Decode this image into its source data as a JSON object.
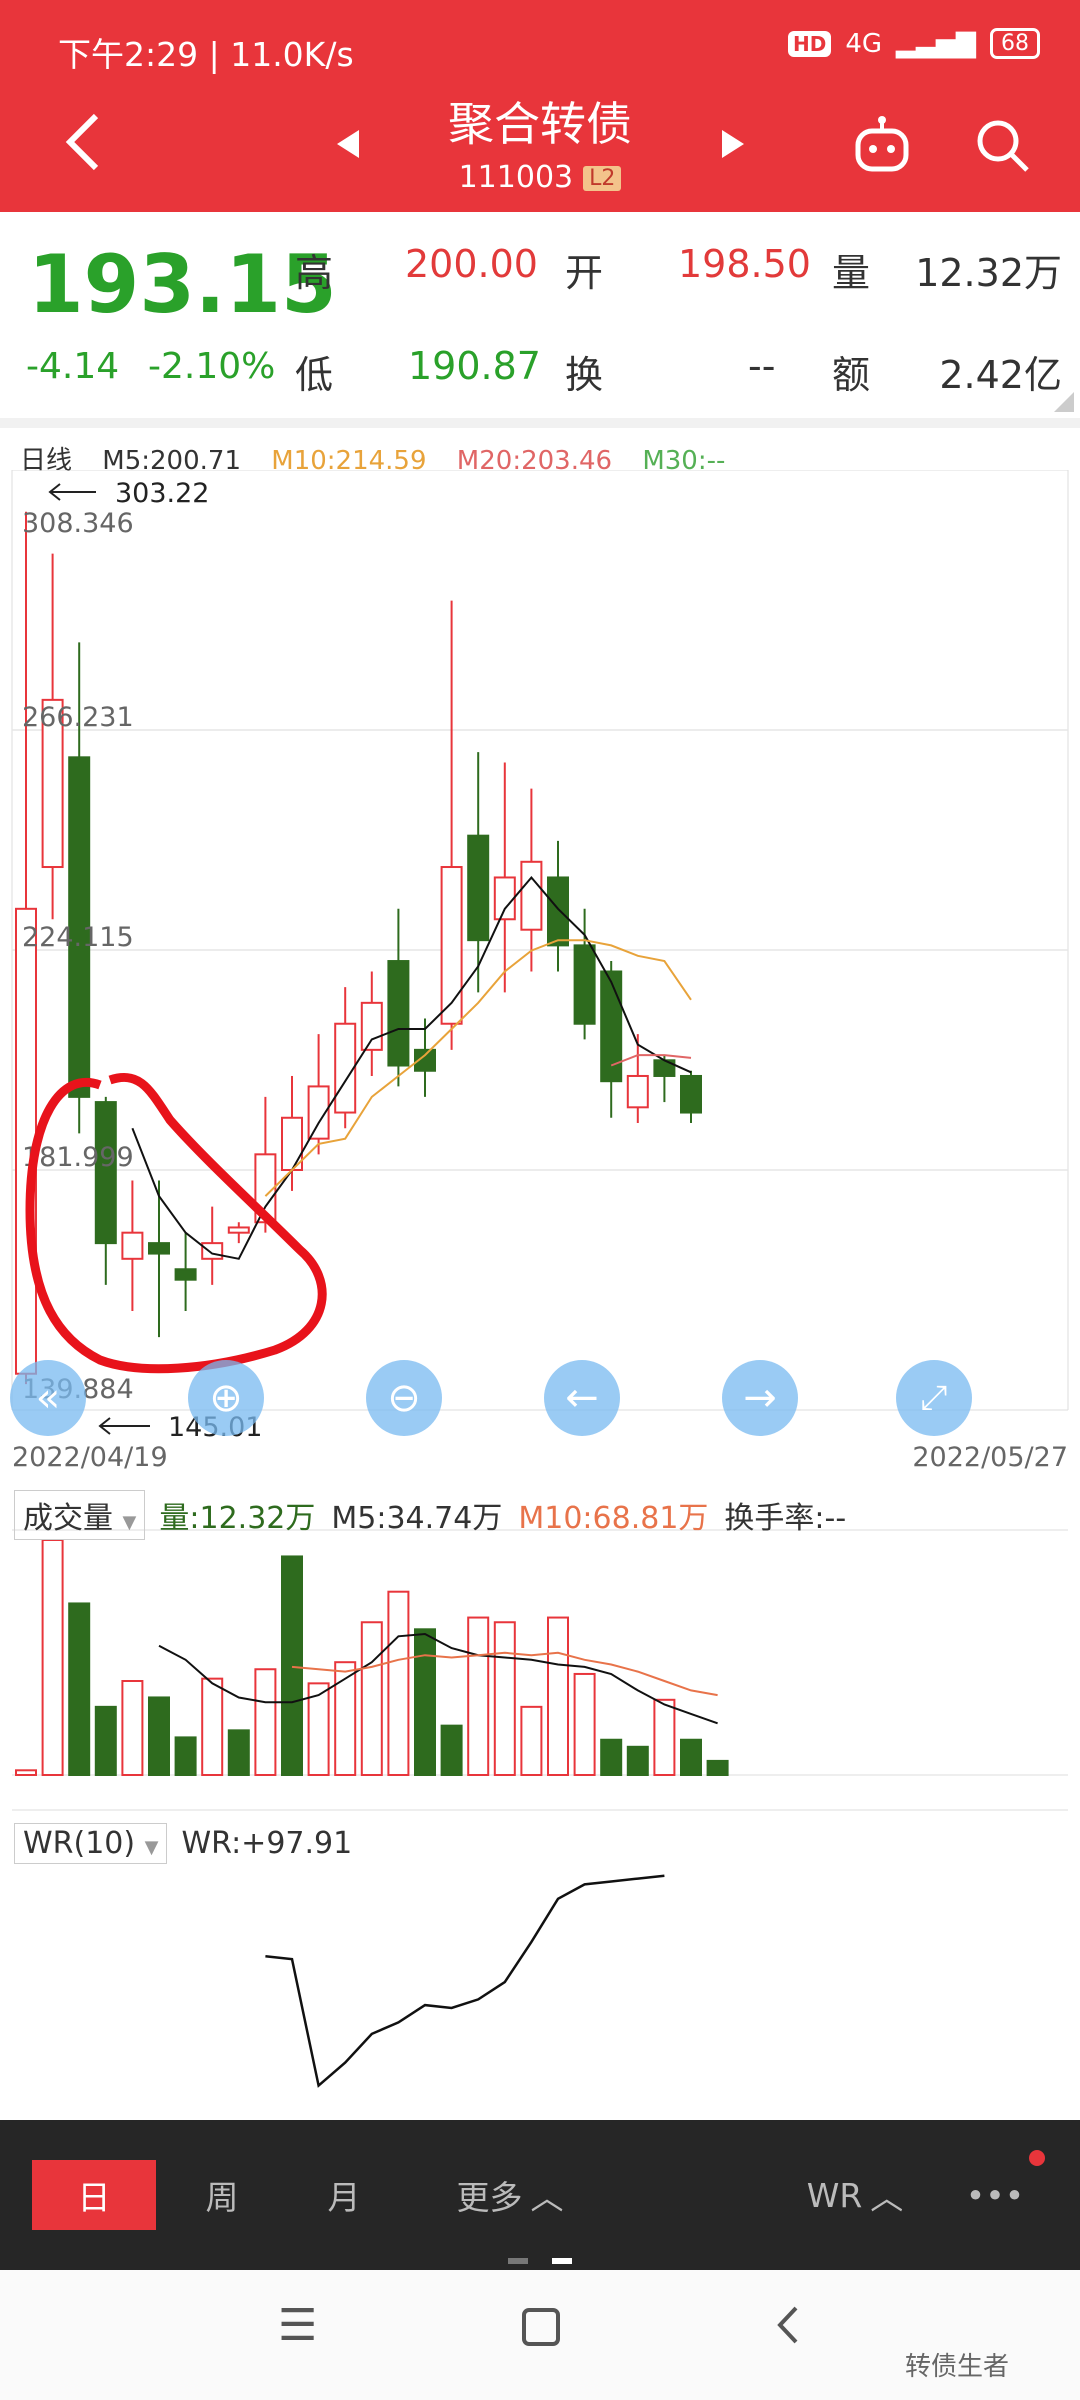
{
  "status": {
    "time": "下午2:29 | 11.0K/s",
    "hd": "HD",
    "net": "4G",
    "battery": "68"
  },
  "header": {
    "title": "聚合转债",
    "code": "111003",
    "level": "L2"
  },
  "quote": {
    "price": "193.15",
    "change": "-4.14",
    "change_pct": "-2.10%",
    "high_label": "高",
    "high": "200.00",
    "open_label": "开",
    "open": "198.50",
    "volume_label": "量",
    "volume": "12.32万",
    "low_label": "低",
    "low": "190.87",
    "turnover_label": "换",
    "turnover": "--",
    "amount_label": "额",
    "amount": "2.42亿"
  },
  "kline": {
    "period": "日线",
    "ma5": "M5:200.71",
    "ma10": "M10:214.59",
    "ma20": "M20:203.46",
    "ma30": "M30:--",
    "max_annot": "303.22",
    "min_annot": "145.01",
    "price_labels": [
      "308.346",
      "266.231",
      "224.115",
      "181.999",
      "139.884"
    ],
    "date_start": "2022/04/19",
    "date_end": "2022/05/27"
  },
  "volume": {
    "selector": "成交量",
    "vol": "量:12.32万",
    "m5": "M5:34.74万",
    "m10": "M10:68.81万",
    "turnover": "换手率:--"
  },
  "wr": {
    "selector": "WR(10)",
    "value": "WR:+97.91"
  },
  "tabs": {
    "day": "日",
    "week": "周",
    "month": "月",
    "more": "更多",
    "indicator": "WR",
    "dots": "•••"
  },
  "watermark": "转债生者",
  "colors": {
    "red": "#e8353b",
    "green": "#2e6b1e",
    "ma10": "#e8a33a",
    "ma20": "#e06666",
    "ma30": "#55b055"
  },
  "chart_data": {
    "type": "candlestick",
    "price_range": [
      139.884,
      308.346
    ],
    "candles": [
      {
        "o": 143,
        "c": 232,
        "h": 308,
        "l": 141,
        "up": true
      },
      {
        "o": 240,
        "c": 272,
        "h": 300,
        "l": 230,
        "up": true
      },
      {
        "o": 261,
        "c": 196,
        "h": 283,
        "l": 189,
        "up": false
      },
      {
        "o": 195,
        "c": 168,
        "h": 196,
        "l": 160,
        "up": false
      },
      {
        "o": 165,
        "c": 170,
        "h": 180,
        "l": 155,
        "up": true
      },
      {
        "o": 168,
        "c": 166,
        "h": 180,
        "l": 150,
        "up": false
      },
      {
        "o": 163,
        "c": 161,
        "h": 170,
        "l": 155,
        "up": false
      },
      {
        "o": 165,
        "c": 168,
        "h": 175,
        "l": 160,
        "up": true
      },
      {
        "o": 170,
        "c": 171,
        "h": 172,
        "l": 168,
        "up": true
      },
      {
        "o": 172,
        "c": 185,
        "h": 196,
        "l": 170,
        "up": true
      },
      {
        "o": 182,
        "c": 192,
        "h": 200,
        "l": 178,
        "up": true
      },
      {
        "o": 188,
        "c": 198,
        "h": 208,
        "l": 185,
        "up": true
      },
      {
        "o": 193,
        "c": 210,
        "h": 217,
        "l": 190,
        "up": true
      },
      {
        "o": 205,
        "c": 214,
        "h": 220,
        "l": 200,
        "up": true
      },
      {
        "o": 222,
        "c": 202,
        "h": 232,
        "l": 198,
        "up": false
      },
      {
        "o": 205,
        "c": 201,
        "h": 211,
        "l": 196,
        "up": false
      },
      {
        "o": 210,
        "c": 240,
        "h": 291,
        "l": 205,
        "up": true
      },
      {
        "o": 246,
        "c": 226,
        "h": 262,
        "l": 216,
        "up": false
      },
      {
        "o": 230,
        "c": 238,
        "h": 260,
        "l": 216,
        "up": true
      },
      {
        "o": 228,
        "c": 241,
        "h": 255,
        "l": 220,
        "up": true
      },
      {
        "o": 238,
        "c": 225,
        "h": 245,
        "l": 220,
        "up": false
      },
      {
        "o": 225,
        "c": 210,
        "h": 232,
        "l": 207,
        "up": false
      },
      {
        "o": 220,
        "c": 199,
        "h": 222,
        "l": 192,
        "up": false
      },
      {
        "o": 194,
        "c": 200,
        "h": 208,
        "l": 191,
        "up": true
      },
      {
        "o": 203,
        "c": 200,
        "h": 204,
        "l": 195,
        "up": false
      },
      {
        "o": 200,
        "c": 193,
        "h": 201,
        "l": 191,
        "up": false
      }
    ],
    "ma5": [
      null,
      null,
      null,
      null,
      190,
      177,
      170,
      166,
      165,
      175,
      182,
      191,
      199,
      207,
      209,
      209,
      214,
      221,
      232,
      238,
      232,
      227,
      218,
      206,
      203,
      200.71
    ],
    "ma10": [
      null,
      null,
      null,
      null,
      null,
      null,
      null,
      null,
      null,
      177,
      182,
      187,
      188,
      196,
      200,
      204,
      209,
      214,
      220,
      224,
      226,
      226,
      225,
      223,
      222,
      214.59
    ],
    "ma20": [
      null,
      null,
      null,
      null,
      null,
      null,
      null,
      null,
      null,
      null,
      null,
      null,
      null,
      null,
      null,
      null,
      null,
      null,
      null,
      null,
      null,
      null,
      202,
      204,
      204,
      203.46
    ],
    "volume": [
      {
        "v": 2,
        "up": true
      },
      {
        "v": 100,
        "up": true
      },
      {
        "v": 73,
        "up": false
      },
      {
        "v": 29,
        "up": false
      },
      {
        "v": 40,
        "up": true
      },
      {
        "v": 33,
        "up": false
      },
      {
        "v": 16,
        "up": false
      },
      {
        "v": 41,
        "up": true
      },
      {
        "v": 19,
        "up": false
      },
      {
        "v": 45,
        "up": true
      },
      {
        "v": 93,
        "up": false
      },
      {
        "v": 39,
        "up": true
      },
      {
        "v": 48,
        "up": true
      },
      {
        "v": 65,
        "up": true
      },
      {
        "v": 78,
        "up": true
      },
      {
        "v": 62,
        "up": false
      },
      {
        "v": 21,
        "up": false
      },
      {
        "v": 67,
        "up": true
      },
      {
        "v": 65,
        "up": true
      },
      {
        "v": 29,
        "up": true
      },
      {
        "v": 67,
        "up": true
      },
      {
        "v": 43,
        "up": true
      },
      {
        "v": 15,
        "up": false
      },
      {
        "v": 12,
        "up": false
      },
      {
        "v": 32,
        "up": true
      },
      {
        "v": 15,
        "up": false
      },
      {
        "v": 6,
        "up": false
      }
    ],
    "vol_m5": [
      null,
      null,
      null,
      null,
      null,
      55,
      49,
      39,
      33,
      31,
      31,
      34,
      41,
      48,
      59,
      60,
      54,
      51,
      50,
      49,
      47,
      46,
      43,
      36,
      30,
      26,
      22
    ],
    "vol_m10": [
      null,
      null,
      null,
      null,
      null,
      null,
      null,
      null,
      null,
      null,
      46,
      45,
      44,
      46,
      49,
      51,
      50,
      51,
      52,
      51,
      52,
      49,
      47,
      44,
      40,
      36,
      34
    ],
    "wr": [
      null,
      null,
      null,
      null,
      null,
      null,
      null,
      null,
      null,
      5,
      4,
      -40,
      -32,
      -22,
      -18,
      -12,
      -13,
      -10,
      -4,
      10,
      25,
      30,
      31,
      32,
      33
    ]
  }
}
